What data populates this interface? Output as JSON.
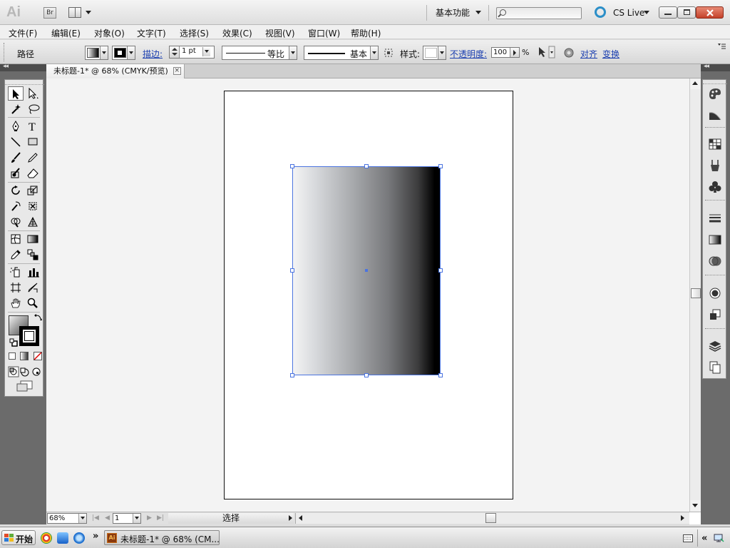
{
  "app": {
    "logo": "Ai",
    "bridge_label": "Br",
    "workspace_label": "基本功能",
    "cs_live_label": "CS Live"
  },
  "menubar": {
    "items": [
      "文件(F)",
      "编辑(E)",
      "对象(O)",
      "文字(T)",
      "选择(S)",
      "效果(C)",
      "视图(V)",
      "窗口(W)",
      "帮助(H)"
    ]
  },
  "controlbar": {
    "object_type": "路径",
    "stroke_label": "描边:",
    "stroke_weight": "1 pt",
    "stroke_profile_label": "等比",
    "brush_label": "基本",
    "style_label": "样式:",
    "opacity_label": "不透明度:",
    "opacity_value": "100",
    "percent": "%",
    "align_label": "对齐",
    "transform_label": "变换"
  },
  "document": {
    "tab_title": "未标题-1* @ 68% (CMYK/预览)",
    "close_glyph": "×"
  },
  "statusbar": {
    "zoom": "68%",
    "page": "1",
    "status_text": "选择"
  },
  "taskbar": {
    "start_label": "开始",
    "task_label": "未标题-1* @ 68% (CM...",
    "task_icon_label": "Ai",
    "overflow": "»"
  },
  "colors": {
    "selection_blue": "#4b74e0",
    "link_blue": "#1b3fb0",
    "cs_live_blue": "#2c8fc8",
    "panel_dark": "#6b6b6b"
  },
  "tools": [
    "selection-tool",
    "direct-selection-tool",
    "magic-wand-tool",
    "lasso-tool",
    "pen-tool",
    "type-tool",
    "line-segment-tool",
    "rectangle-tool",
    "paintbrush-tool",
    "pencil-tool",
    "blob-brush-tool",
    "eraser-tool",
    "rotate-tool",
    "scale-tool",
    "warp-tool",
    "free-transform-tool",
    "shape-builder-tool",
    "perspective-grid-tool",
    "mesh-tool",
    "gradient-tool",
    "eyedropper-tool",
    "blend-tool",
    "symbol-sprayer-tool",
    "column-graph-tool",
    "artboard-tool",
    "slice-tool",
    "hand-tool",
    "zoom-tool"
  ],
  "right_panels": [
    "color-icon",
    "color-guide-icon",
    "swatches-icon",
    "brushes-icon",
    "symbols-icon",
    "stroke-icon",
    "gradient-icon",
    "transparency-icon",
    "appearance-icon",
    "graphic-styles-icon",
    "layers-icon",
    "artboards-icon"
  ]
}
